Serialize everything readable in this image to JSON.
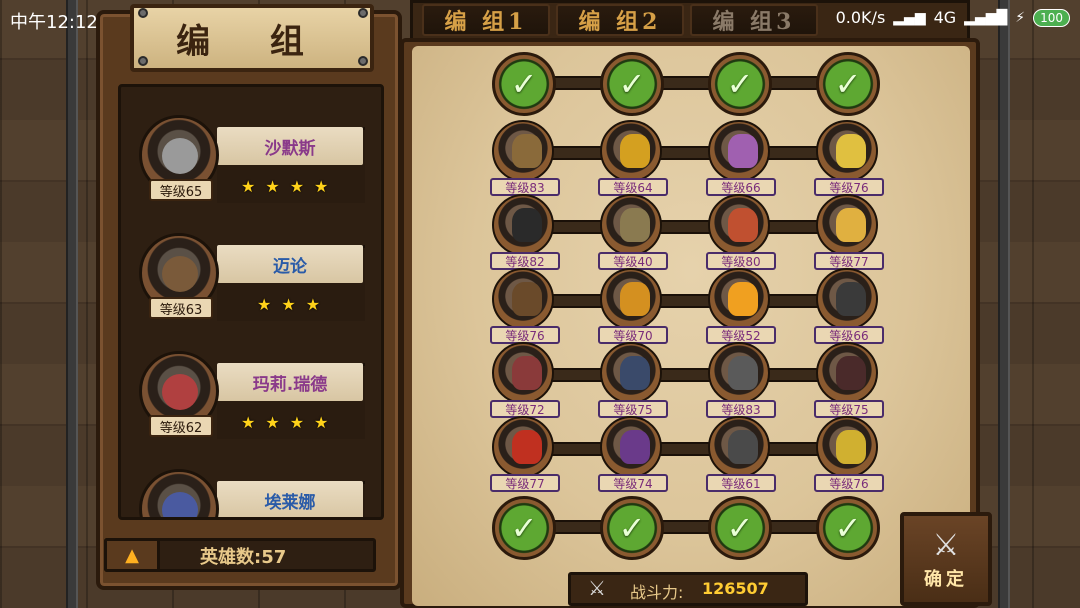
{
  "status_bar": {
    "time": "中午12:12",
    "network_speed": "0.0K/s",
    "network_type": "4G",
    "battery": "100"
  },
  "panel_title": "编 组",
  "tabs": [
    {
      "label": "编 组1",
      "active": true
    },
    {
      "label": "编 组2",
      "active": true
    },
    {
      "label": "编 组3",
      "active": false
    }
  ],
  "heroes": [
    {
      "name": "沙默斯",
      "level": "等级65",
      "stars": 4,
      "name_color": "purple"
    },
    {
      "name": "迈论",
      "level": "等级63",
      "stars": 3,
      "name_color": "blue"
    },
    {
      "name": "玛莉.瑞德",
      "level": "等级62",
      "stars": 4,
      "name_color": "purple"
    },
    {
      "name": "埃莱娜",
      "level": "",
      "stars": 0,
      "name_color": "blue"
    }
  ],
  "hero_count": "英雄数:57",
  "formation": {
    "slot_icon": "check-icon",
    "units": [
      [
        "等级83",
        "等级64",
        "等级66",
        "等级76"
      ],
      [
        "等级82",
        "等级40",
        "等级80",
        "等级77"
      ],
      [
        "等级76",
        "等级70",
        "等级52",
        "等级66"
      ],
      [
        "等级72",
        "等级75",
        "等级83",
        "等级75"
      ],
      [
        "等级77",
        "等级74",
        "等级61",
        "等级76"
      ]
    ],
    "unit_colors": [
      [
        "#8a6a3a",
        "#d4a020",
        "#a060b0",
        "#e0c040"
      ],
      [
        "#2a2a2a",
        "#8a7a50",
        "#c05030",
        "#e0b040"
      ],
      [
        "#6a4a2a",
        "#d49020",
        "#f0a020",
        "#3a3a3a"
      ],
      [
        "#8a3a3a",
        "#3a4a6a",
        "#5a5a5a",
        "#4a2a2a"
      ],
      [
        "#c03020",
        "#6a3a8a",
        "#4a4a4a",
        "#d0b030"
      ]
    ]
  },
  "power": {
    "label": "战斗力:",
    "value": "126507",
    "icon": "crossed-swords-icon"
  },
  "confirm": {
    "label": "确定",
    "icon": "crossed-swords-icon"
  }
}
